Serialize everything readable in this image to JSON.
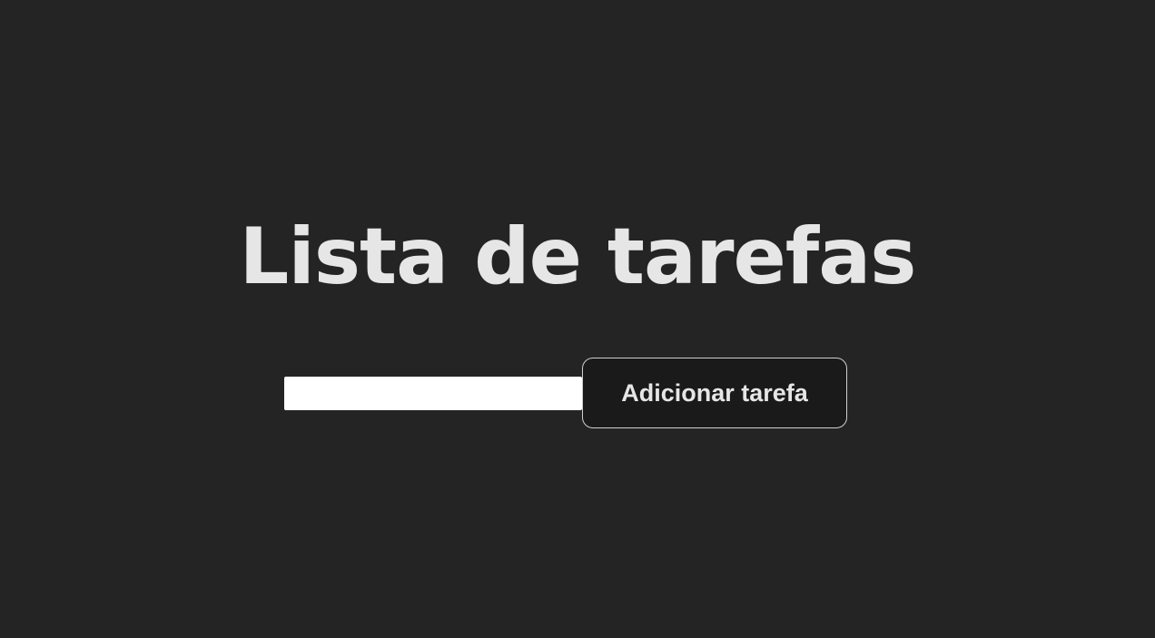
{
  "page": {
    "title": "Lista de tarefas"
  },
  "form": {
    "input_value": "",
    "input_placeholder": "",
    "add_button_label": "Adicionar tarefa"
  },
  "colors": {
    "background": "#242424",
    "text": "#e6e6e6",
    "button_background": "#1a1a1a",
    "button_border": "#cfcfcf",
    "input_background": "#ffffff"
  }
}
